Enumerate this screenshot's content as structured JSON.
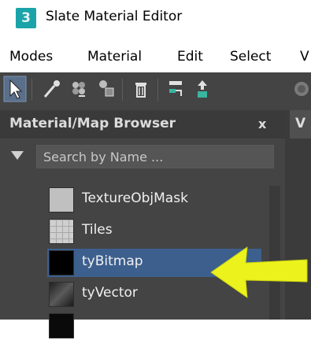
{
  "window": {
    "app_icon_label": "3",
    "title": "Slate Material Editor"
  },
  "menu": {
    "items": [
      "Modes",
      "Material",
      "Edit",
      "Select",
      "V"
    ]
  },
  "toolbar": {
    "buttons": [
      "select-arrow-icon",
      "eyedropper-icon",
      "pick-material-icon",
      "assign-material-icon",
      "delete-icon",
      "layout-icon",
      "move-children-icon",
      "background-icon"
    ]
  },
  "browser": {
    "title": "Material/Map Browser",
    "close_label": "x",
    "search": {
      "placeholder": "Search by Name ...",
      "value": ""
    },
    "items": [
      {
        "label": "TextureObjMask",
        "swatch": "flat-gray",
        "selected": false
      },
      {
        "label": "Tiles",
        "swatch": "tile-grid",
        "selected": false
      },
      {
        "label": "tyBitmap",
        "swatch": "black",
        "selected": true
      },
      {
        "label": "tyVector",
        "swatch": "dark-gradient",
        "selected": false
      },
      {
        "label": "",
        "swatch": "black",
        "selected": false
      }
    ]
  },
  "view_pane": {
    "tab_label": "V"
  },
  "annotation": {
    "arrow_color": "#ecf21c"
  },
  "colors": {
    "panel_bg": "#444444",
    "header_bg": "#3a3a3a",
    "selection": "#3c5f8e",
    "app_icon": "#1aa3a8"
  }
}
